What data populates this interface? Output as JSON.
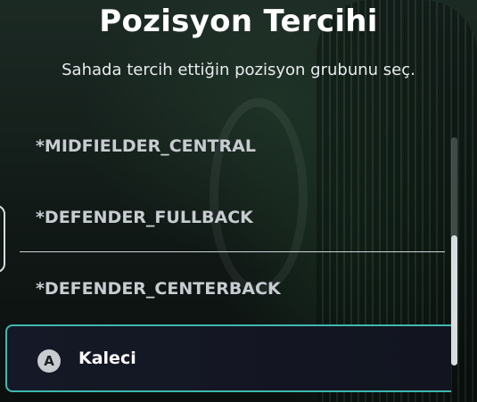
{
  "header": {
    "title": "Pozisyon Tercihi",
    "subtitle": "Sahada tercih ettiğin pozisyon grubunu seç."
  },
  "options": [
    {
      "label": "*MIDFIELDER_CENTRAL"
    },
    {
      "label": "*DEFENDER_FULLBACK"
    },
    {
      "label": "*DEFENDER_CENTERBACK"
    }
  ],
  "selected_option": {
    "button_glyph": "A",
    "label": "Kaleci"
  },
  "scrollbar": {
    "position_fraction": 0.43
  },
  "colors": {
    "accent": "#3fb7b0",
    "selected_bg": "#151826",
    "option_text": "#c7ccd0"
  }
}
